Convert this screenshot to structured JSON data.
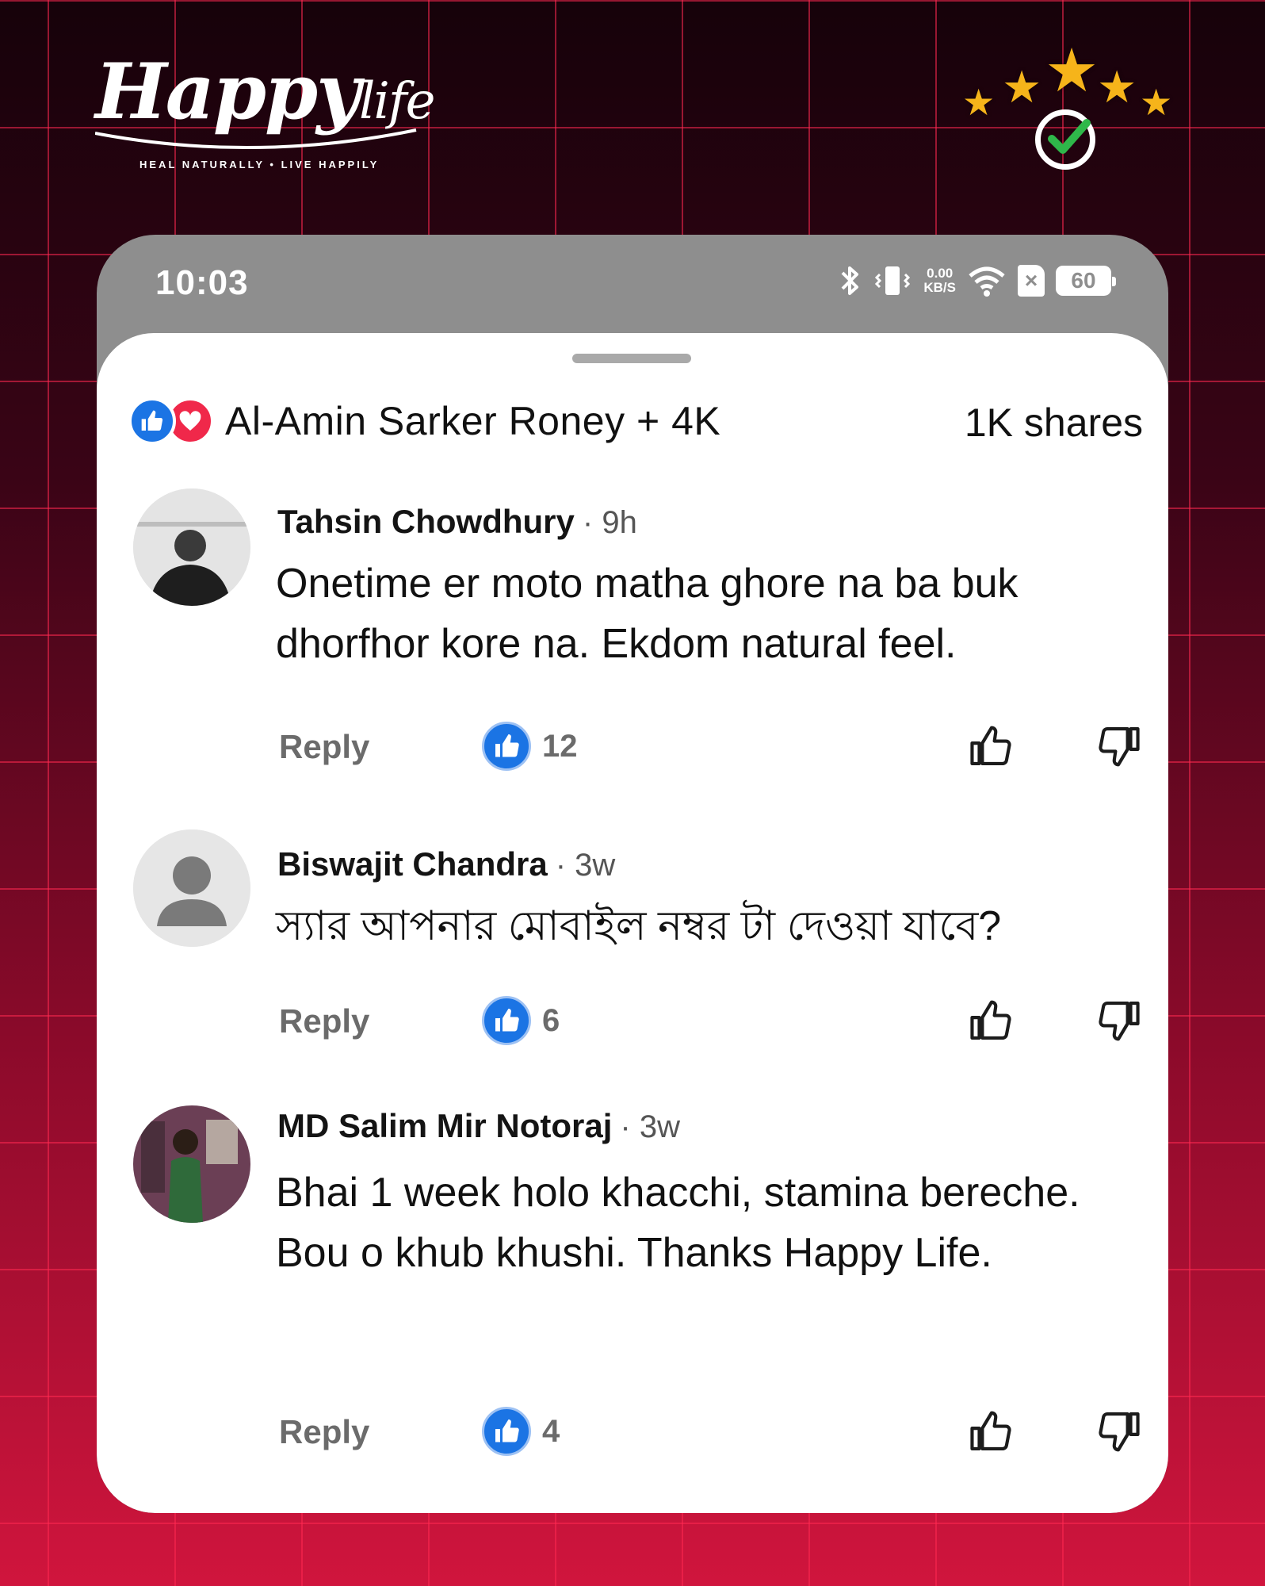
{
  "brand": {
    "logo_main": "Happy",
    "logo_script": "life",
    "tagline": "HEAL NATURALLY  •  LIVE HAPPILY"
  },
  "rating_badge": {
    "stars": 5,
    "icon": "verified-check-icon"
  },
  "status_bar": {
    "time": "10:03",
    "net_speed_value": "0.00",
    "net_speed_unit": "KB/S",
    "battery": "60"
  },
  "post_meta": {
    "reactors": "Al-Amin Sarker Roney + 4K",
    "shares": "1K shares"
  },
  "comments": [
    {
      "name": "Tahsin Chowdhury",
      "time": "· 9h",
      "text": "Onetime er moto matha ghore na ba buk dhorfhor kore na. Ekdom natural feel.",
      "reply": "Reply",
      "likes": "12"
    },
    {
      "name": "Biswajit Chandra",
      "time": "· 3w",
      "text": "স্যার আপনার মোবাইল নম্বর টা দেওয়া যাবে?",
      "reply": "Reply",
      "likes": "6"
    },
    {
      "name": "MD Salim Mir Notoraj",
      "time": "· 3w",
      "text": "Bhai 1 week holo khacchi, stamina bereche. Bou o khub khushi. Thanks Happy Life.",
      "reply": "Reply",
      "likes": "4"
    }
  ],
  "colors": {
    "facebook_blue": "#1b74e4",
    "love_red": "#f0284a",
    "star_gold": "#f6b41a",
    "check_green": "#2fb84a"
  }
}
